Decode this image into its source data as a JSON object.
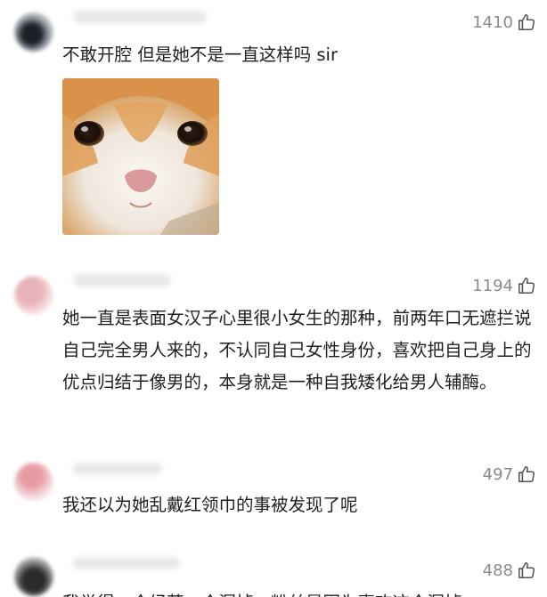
{
  "comments": [
    {
      "likes": "1410",
      "text": "不敢开腔 但是她不是一直这样吗 sir",
      "has_sticker": true,
      "sticker_icon": "cat-face-sticker"
    },
    {
      "likes": "1194",
      "text": "她一直是表面女汉子心里很小女生的那种，前两年口无遮拦说自己完全男人来的，不认同自己女性身份，喜欢把自己身上的优点归结于像男的，本身就是一种自我矮化给男人辅酶。"
    },
    {
      "likes": "497",
      "text": "我还以为她乱戴红领巾的事被发现了呢"
    },
    {
      "likes": "488",
      "text": "我觉得一个经营一个漏掉，粉丝是因为喜欢这个漏掉"
    }
  ],
  "colors": {
    "text": "#1f1f1f",
    "likes": "#8a8a8a",
    "background": "#ffffff"
  }
}
